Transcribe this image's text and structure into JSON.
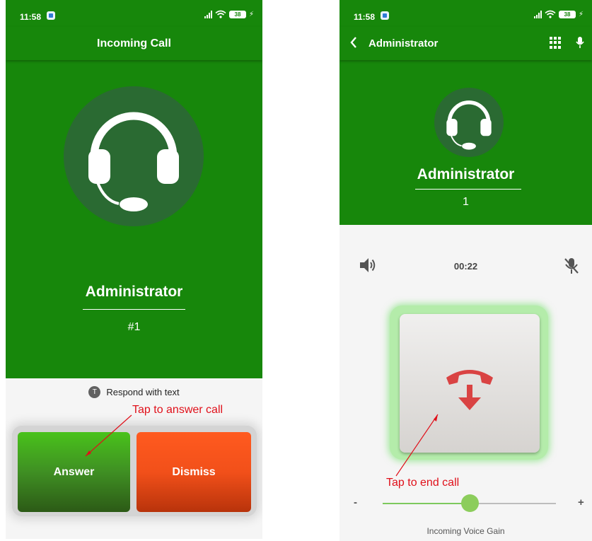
{
  "left_screen": {
    "status": {
      "time": "11:58",
      "battery": "38"
    },
    "title": "Incoming Call",
    "avatar_icon": "headset-icon",
    "caller_name": "Administrator",
    "caller_number": "#1",
    "respond": {
      "icon_letter": "T",
      "label": "Respond with text"
    },
    "buttons": {
      "answer": {
        "label": "Answer",
        "color": "#3f8f23"
      },
      "dismiss": {
        "label": "Dismiss",
        "color": "#f2501a"
      }
    },
    "annotation": "Tap to answer call"
  },
  "right_screen": {
    "status": {
      "time": "11:58",
      "battery": "38"
    },
    "title": "Administrator",
    "toolbar_icons": [
      "back-icon",
      "keypad-icon",
      "microphone-icon"
    ],
    "avatar_icon": "headset-icon",
    "caller_name": "Administrator",
    "caller_number": "1",
    "timer": "00:22",
    "end_call_icon": "hang-up-icon",
    "gain": {
      "minus": "-",
      "plus": "+",
      "label": "Incoming Voice Gain",
      "value": 0.5
    },
    "annotation": "Tap to end call"
  },
  "colors": {
    "primary": "#17870b",
    "avatar_bg": "#2a6a32",
    "annotation": "#e0101a",
    "end_call_glow": "#b4ecaa",
    "hang_up": "#d94343",
    "slider": "#8ccd5c"
  }
}
